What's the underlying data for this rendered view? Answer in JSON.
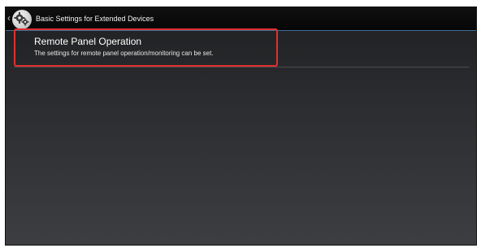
{
  "header": {
    "back_icon": "chevron-left-icon",
    "icon": "gear-icon",
    "title": "Basic Settings for Extended Devices"
  },
  "items": [
    {
      "title": "Remote Panel Operation",
      "description": "The settings for remote panel operation/monitoring can be set."
    }
  ],
  "colors": {
    "highlight_border": "#e0302f",
    "header_rule": "#3f6e96"
  }
}
